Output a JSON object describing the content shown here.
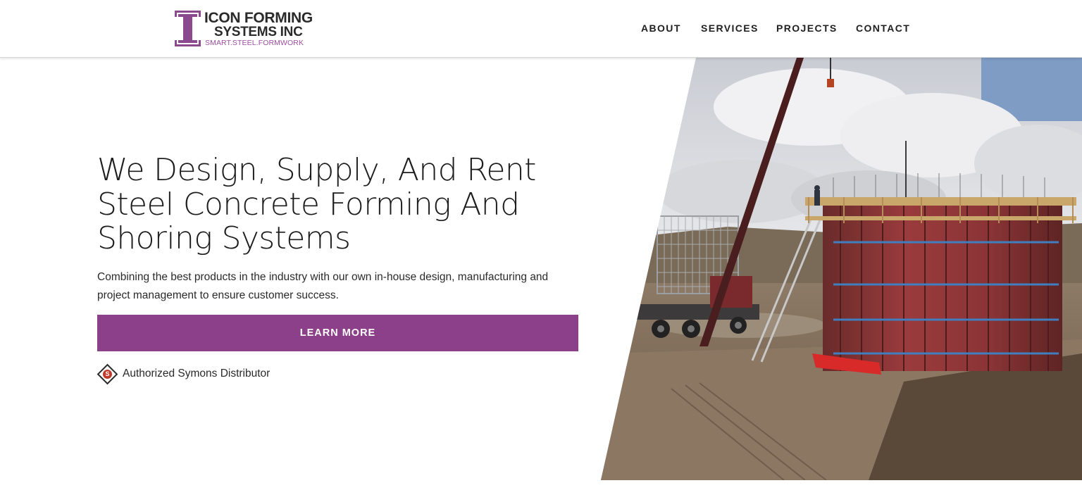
{
  "header": {
    "logo": {
      "line1": "ICON FORMING",
      "line2": "SYSTEMS INC",
      "tagline": "SMART.STEEL.FORMWORK"
    },
    "nav": [
      {
        "label": "ABOUT"
      },
      {
        "label": "SERVICES"
      },
      {
        "label": "PROJECTS"
      },
      {
        "label": "CONTACT"
      }
    ]
  },
  "hero": {
    "title": "We Design, Supply, And Rent Steel Concrete Forming And Shoring Systems",
    "subtitle": "Combining the best products in the industry with our own in-house design, manufacturing and project management to ensure customer success.",
    "cta_label": "LEARN MORE",
    "distributor_text": "Authorized Symons Distributor",
    "distributor_badge_letter": "S",
    "image_alt": "Construction site with red steel circular formwork and crane truck"
  },
  "colors": {
    "brand_purple": "#8c4089",
    "logo_purple": "#8c4a8e",
    "text_dark": "#1d1d1d"
  },
  "icons": {
    "logo_mark": "icon-forming-i-logo",
    "distributor_badge": "symons-diamond-icon"
  }
}
